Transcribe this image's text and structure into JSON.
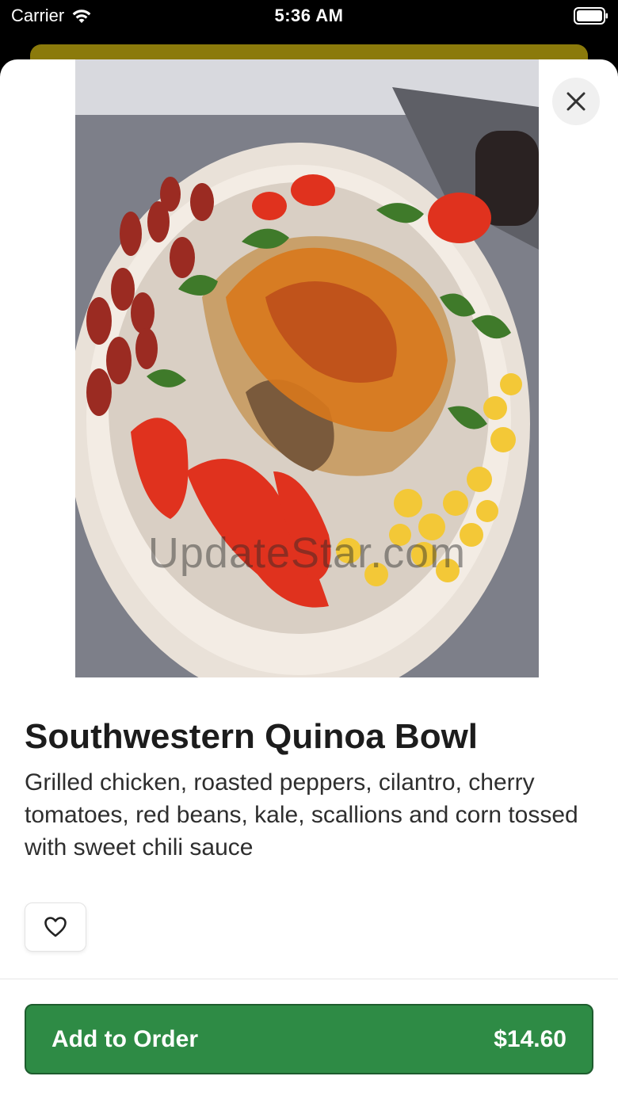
{
  "status_bar": {
    "carrier": "Carrier",
    "time": "5:36 AM",
    "icons": [
      "wifi-icon",
      "battery-icon"
    ]
  },
  "item": {
    "image_alt": "Southwestern Quinoa Bowl",
    "watermark": "UpdateStar.com",
    "title": "Southwestern Quinoa Bowl",
    "description": "Grilled chicken, roasted peppers, cilantro, cherry tomatoes, red beans, kale, scallions and corn tossed with sweet chili sauce"
  },
  "actions": {
    "close_icon": "close-icon",
    "favorite_icon": "heart-icon",
    "add_to_order_label": "Add to Order",
    "price": "$14.60"
  },
  "colors": {
    "accent_green": "#2e8b45",
    "underlay_gold": "#8b7a0b"
  }
}
